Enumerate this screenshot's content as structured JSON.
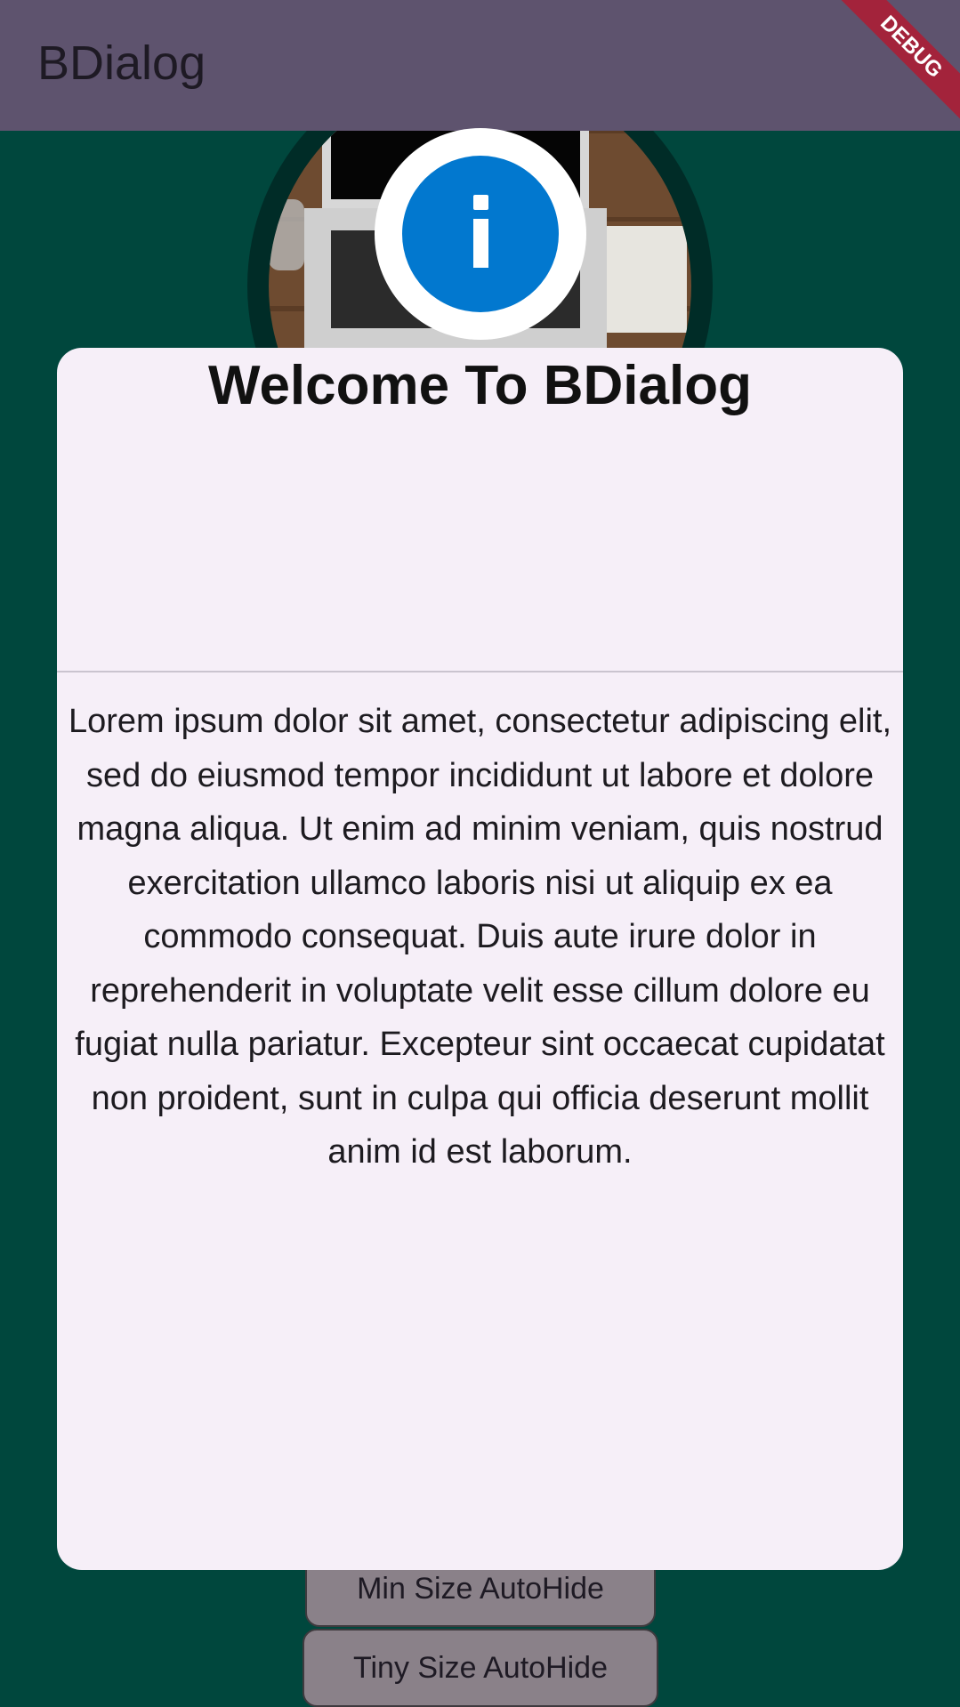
{
  "appbar": {
    "title": "BDialog"
  },
  "debug_banner": "DEBUG",
  "background_buttons": [
    {
      "label": "Min Size AutoHide"
    },
    {
      "label": "Tiny Size AutoHide"
    }
  ],
  "dialog": {
    "icon": "info-icon",
    "title": "Welcome To BDialog",
    "body": "Lorem ipsum dolor sit amet, consectetur adipiscing elit, sed do eiusmod tempor incididunt ut labore et dolore magna aliqua. Ut enim ad minim veniam, quis nostrud exercitation ullamco laboris nisi ut aliquip ex ea commodo consequat. Duis aute irure dolor in reprehenderit in voluptate velit esse cillum dolore eu fugiat nulla pariatur. Excepteur sint occaecat cupidatat non proident, sunt in culpa qui officia deserunt mollit anim id est laborum."
  },
  "colors": {
    "appbar": "#5e536e",
    "background": "#00473d",
    "dialog": "#f6eff8",
    "info_icon": "#0278cf",
    "debug_ribbon": "#a3233b"
  }
}
